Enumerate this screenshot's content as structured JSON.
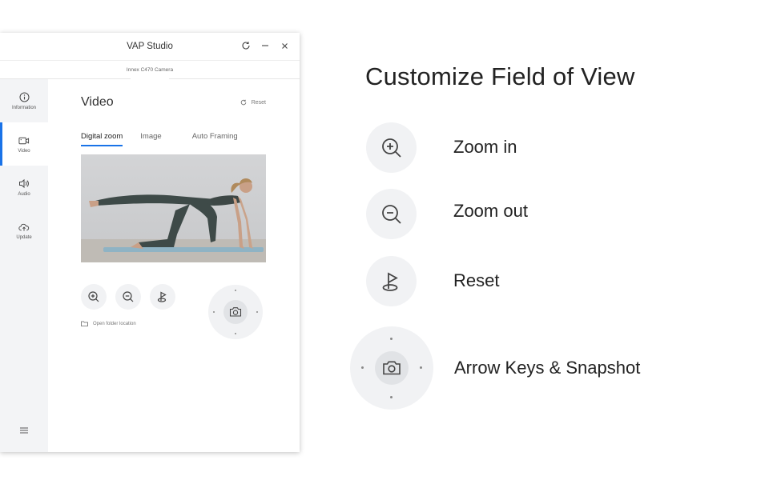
{
  "window": {
    "title": "VAP Studio",
    "camera_name": "Innex C470 Camera"
  },
  "sidebar": {
    "items": [
      {
        "label": "Information",
        "icon": "info-icon"
      },
      {
        "label": "Video",
        "icon": "video-icon",
        "active": true
      },
      {
        "label": "Audio",
        "icon": "speaker-icon"
      },
      {
        "label": "Update",
        "icon": "cloud-upload-icon"
      }
    ],
    "menu_icon": "hamburger-menu-icon"
  },
  "main": {
    "title": "Video",
    "reset_label": "Reset",
    "tabs": [
      {
        "label": "Digital zoom",
        "active": true
      },
      {
        "label": "Image"
      },
      {
        "label": "Auto Framing"
      }
    ],
    "open_folder_label": "Open folder location"
  },
  "legend": {
    "heading": "Customize Field of View",
    "items": [
      {
        "icon": "zoom-in-icon",
        "label": "Zoom in"
      },
      {
        "icon": "zoom-out-icon",
        "label": "Zoom out"
      },
      {
        "icon": "reset-view-icon",
        "label": "Reset"
      },
      {
        "icon": "camera-icon",
        "label": "Arrow Keys & Snapshot"
      }
    ]
  },
  "colors": {
    "accent": "#1a73e8",
    "control_bg": "#f1f2f4",
    "sidebar_bg": "#f3f4f6"
  }
}
